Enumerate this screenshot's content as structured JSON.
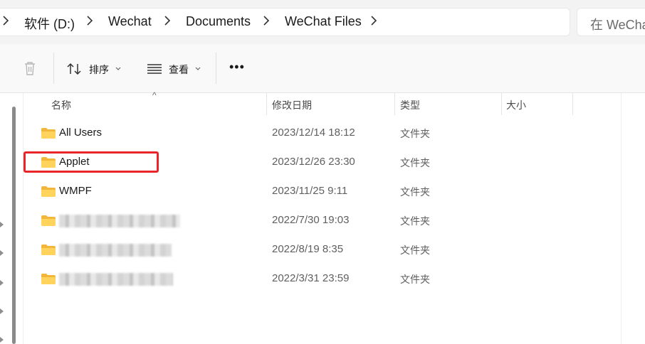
{
  "address_bar": {
    "crumbs": [
      "软件 (D:)",
      "Wechat",
      "Documents",
      "WeChat Files"
    ],
    "search_placeholder": "在 WeChat"
  },
  "toolbar": {
    "sort_label": "排序",
    "view_label": "查看",
    "more_label": "•••"
  },
  "columns": {
    "name": "名称",
    "date": "修改日期",
    "type": "类型",
    "size": "大小"
  },
  "files": [
    {
      "name": "All Users",
      "date": "2023/12/14 18:12",
      "type": "文件夹"
    },
    {
      "name": "Applet",
      "date": "2023/12/26 23:30",
      "type": "文件夹"
    },
    {
      "name": "WMPF",
      "date": "2023/11/25 9:11",
      "type": "文件夹"
    },
    {
      "name": "",
      "date": "2022/7/30 19:03",
      "type": "文件夹"
    },
    {
      "name": "",
      "date": "2022/8/19 8:35",
      "type": "文件夹"
    },
    {
      "name": "",
      "date": "2022/3/31 23:59",
      "type": "文件夹"
    }
  ],
  "colors": {
    "highlight": "#e8262a",
    "folder": "#f6c744"
  }
}
